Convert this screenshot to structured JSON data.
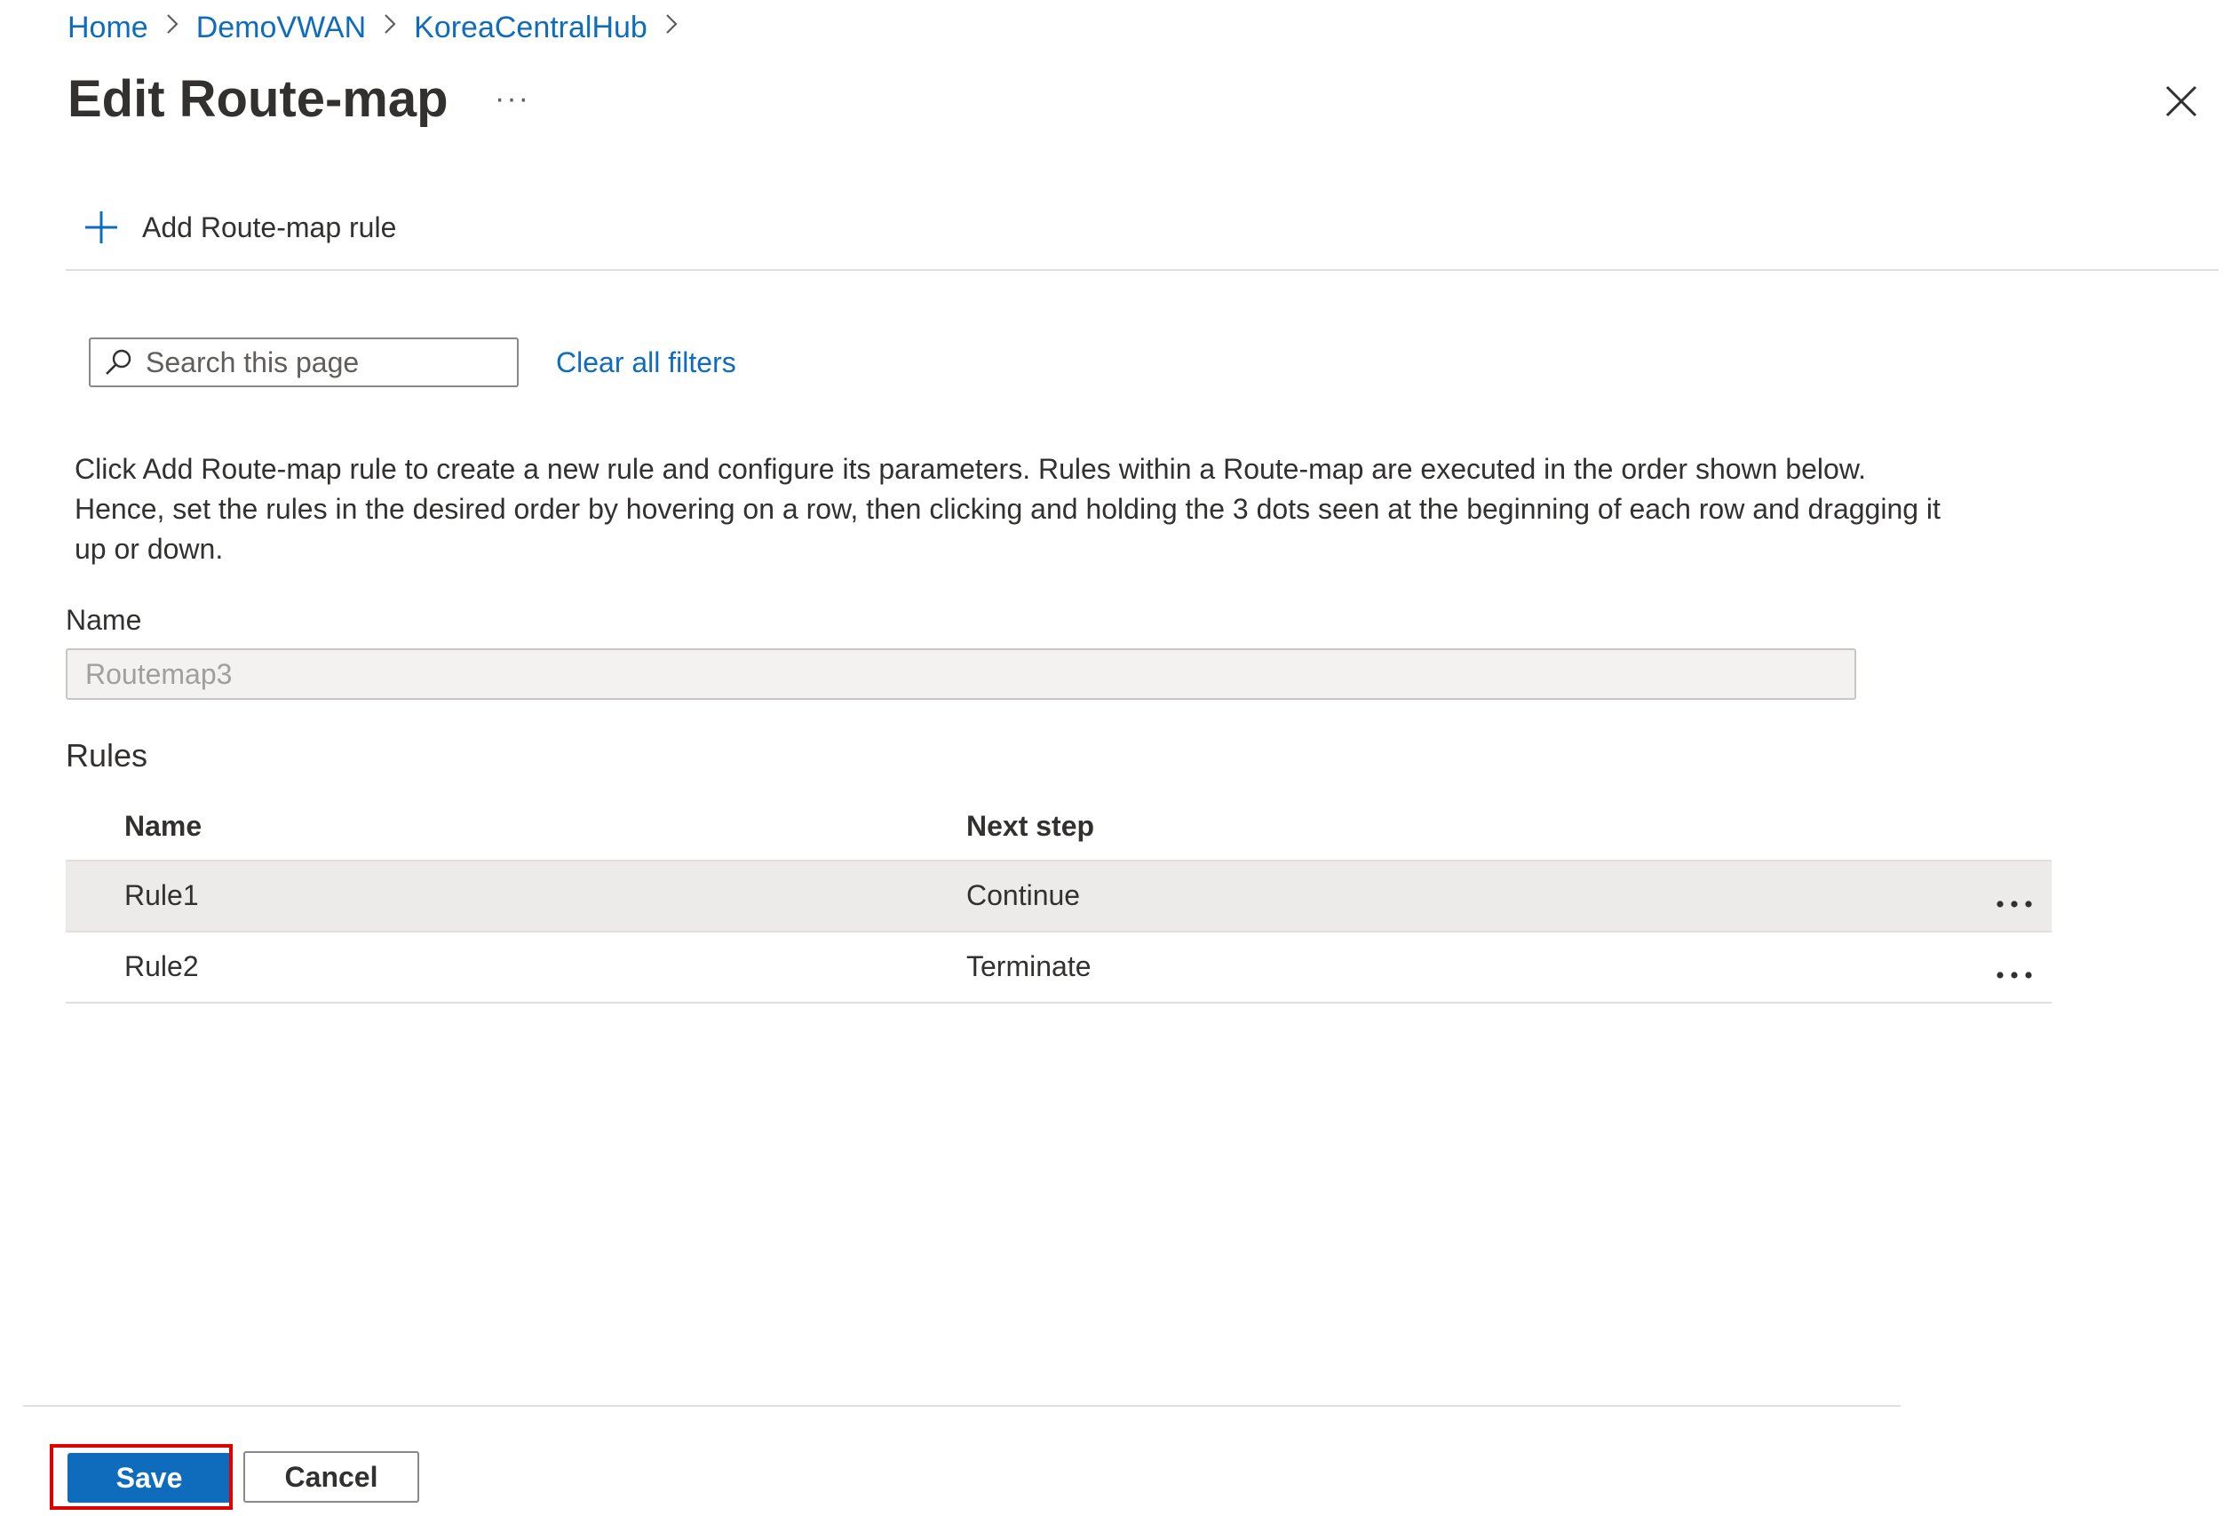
{
  "breadcrumb": {
    "items": [
      "Home",
      "DemoVWAN",
      "KoreaCentralHub"
    ],
    "separator": ">"
  },
  "header": {
    "title": "Edit Route-map",
    "more_label": "···"
  },
  "toolbar": {
    "add_rule_label": "Add Route-map rule"
  },
  "search": {
    "placeholder": "Search this page",
    "clear_filters_label": "Clear all filters"
  },
  "description": "Click Add Route-map rule to create a new rule and configure its parameters. Rules within a Route-map are executed in the order shown below. Hence, set the rules in the desired order by hovering on a row, then clicking and holding the 3 dots seen at the beginning of each row and dragging it up or down.",
  "name_field": {
    "label": "Name",
    "value": "Routemap3"
  },
  "rules": {
    "label": "Rules",
    "columns": [
      "Name",
      "Next step"
    ],
    "rows": [
      {
        "name": "Rule1",
        "next_step": "Continue",
        "selected": true
      },
      {
        "name": "Rule2",
        "next_step": "Terminate",
        "selected": false
      }
    ]
  },
  "footer": {
    "save_label": "Save",
    "cancel_label": "Cancel"
  },
  "colors": {
    "accent": "#0f6cbd",
    "highlight_box": "#e00000",
    "selected_row": "#edebe9"
  },
  "icons": [
    "chevron-right-icon",
    "more-icon",
    "close-icon",
    "plus-icon",
    "search-icon",
    "more-horizontal-icon"
  ]
}
